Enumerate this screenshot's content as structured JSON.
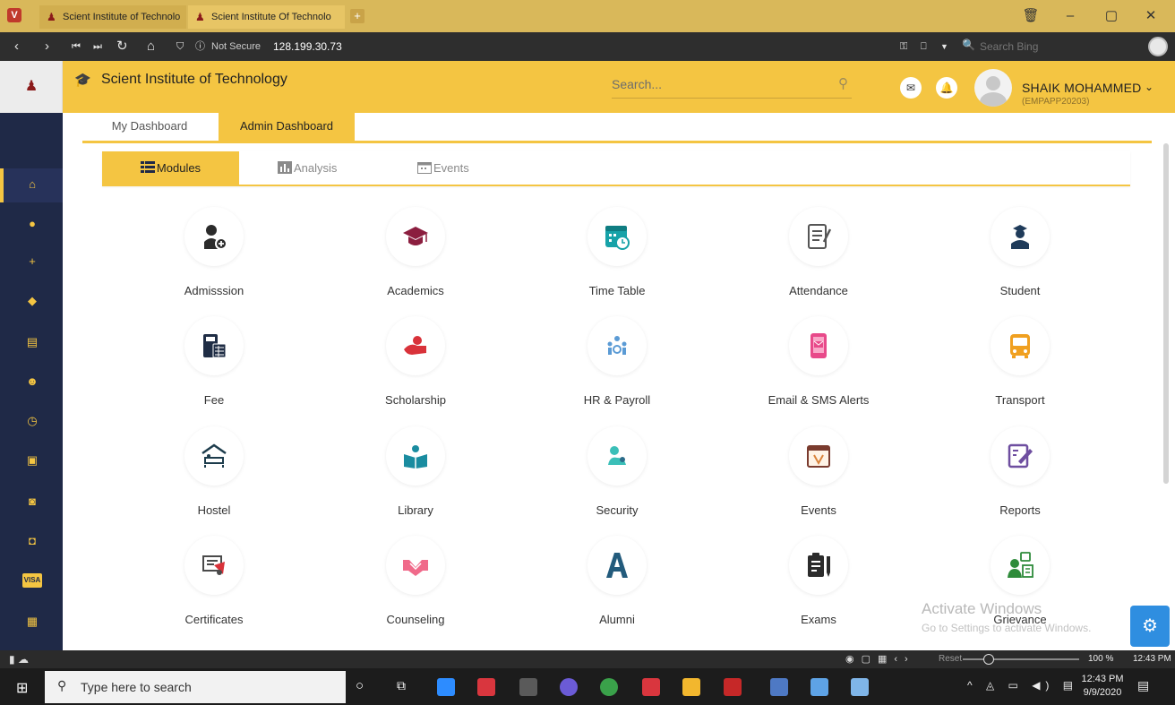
{
  "browser": {
    "tabs": [
      {
        "label": "Scient Institute of Technolo"
      },
      {
        "label": "Scient Institute Of Technolo"
      }
    ],
    "security_label": "Not Secure",
    "address": "128.199.30.73",
    "search_placeholder": "Search Bing"
  },
  "header": {
    "title": "Scient Institute of Technology",
    "search_placeholder": "Search...",
    "user_name": "SHAIK MOHAMMED",
    "user_code": "(EMPAPP20203)"
  },
  "dashboard_tabs": {
    "my": "My Dashboard",
    "admin": "Admin Dashboard"
  },
  "sub_tabs": {
    "modules": "Modules",
    "analysis": "Analysis",
    "events": "Events"
  },
  "modules": [
    {
      "label": "Admisssion"
    },
    {
      "label": "Academics"
    },
    {
      "label": "Time Table"
    },
    {
      "label": "Attendance"
    },
    {
      "label": "Student"
    },
    {
      "label": "Fee"
    },
    {
      "label": "Scholarship"
    },
    {
      "label": "HR & Payroll"
    },
    {
      "label": "Email & SMS Alerts"
    },
    {
      "label": "Transport"
    },
    {
      "label": "Hostel"
    },
    {
      "label": "Library"
    },
    {
      "label": "Security"
    },
    {
      "label": "Events"
    },
    {
      "label": "Reports"
    },
    {
      "label": "Certificates"
    },
    {
      "label": "Counseling"
    },
    {
      "label": "Alumni"
    },
    {
      "label": "Exams"
    },
    {
      "label": "Grievance"
    }
  ],
  "watermark": {
    "line1": "Activate Windows",
    "line2": "Go to Settings to activate Windows."
  },
  "statusbar": {
    "reset": "Reset",
    "zoom": "100 %",
    "time": "12:43 PM"
  },
  "taskbar": {
    "search_placeholder": "Type here to search",
    "time": "12:43 PM",
    "date": "9/9/2020"
  },
  "colors": {
    "accent": "#f4c542",
    "sidebar": "#1f2947"
  }
}
